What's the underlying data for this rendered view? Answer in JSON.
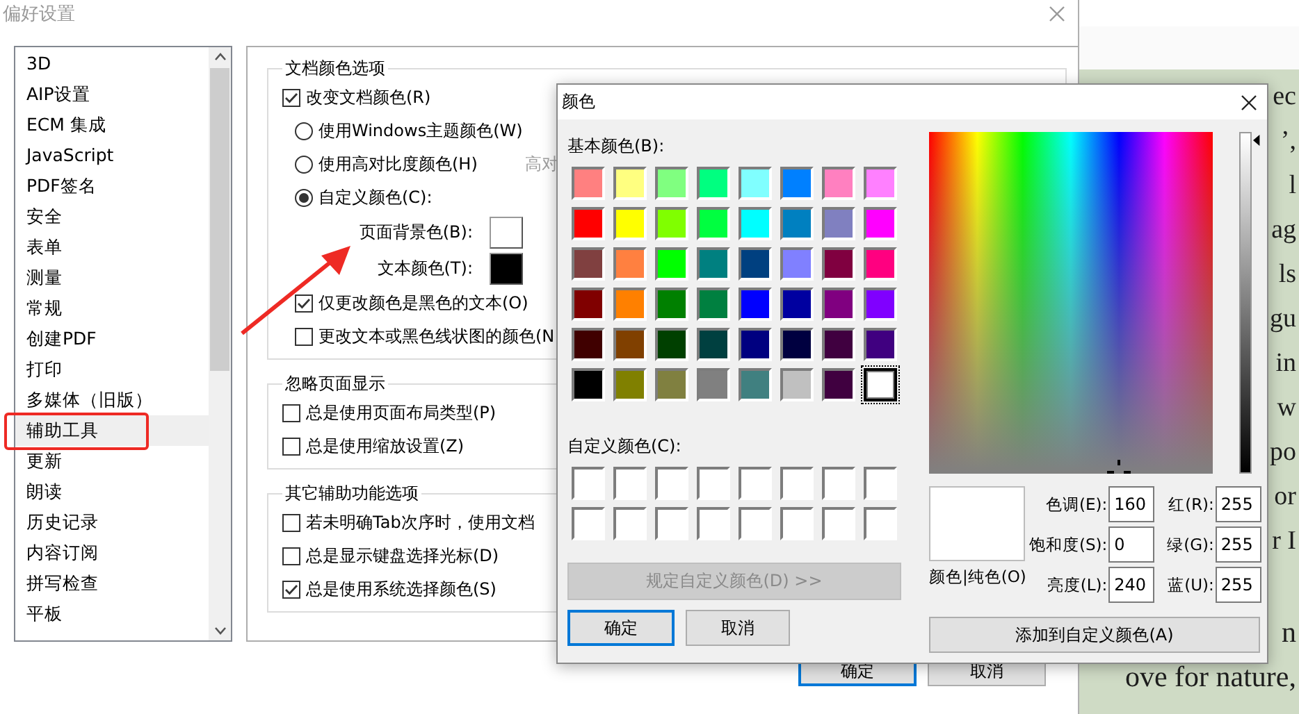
{
  "preferences": {
    "title": "偏好设置",
    "categories": [
      {
        "label": "3D",
        "selected": false
      },
      {
        "label": "AIP设置",
        "selected": false
      },
      {
        "label": "ECM 集成",
        "selected": false
      },
      {
        "label": "JavaScript",
        "selected": false
      },
      {
        "label": "PDF签名",
        "selected": false
      },
      {
        "label": "安全",
        "selected": false
      },
      {
        "label": "表单",
        "selected": false
      },
      {
        "label": "测量",
        "selected": false
      },
      {
        "label": "常规",
        "selected": false
      },
      {
        "label": "创建PDF",
        "selected": false
      },
      {
        "label": "打印",
        "selected": false
      },
      {
        "label": "多媒体（旧版）",
        "selected": false
      },
      {
        "label": "辅助工具",
        "selected": true
      },
      {
        "label": "更新",
        "selected": false
      },
      {
        "label": "朗读",
        "selected": false
      },
      {
        "label": "历史记录",
        "selected": false
      },
      {
        "label": "内容订阅",
        "selected": false
      },
      {
        "label": "拼写检查",
        "selected": false
      },
      {
        "label": "平板",
        "selected": false
      }
    ],
    "groups": [
      {
        "title": "文档颜色选项",
        "items": [
          {
            "kind": "checkbox",
            "label": "改变文档颜色(R)",
            "checked": true,
            "children": [
              {
                "kind": "radio",
                "label": "使用Windows主题颜色(W)",
                "selected": false
              },
              {
                "kind": "radio",
                "label": "使用高对比度颜色(H)",
                "selected": false,
                "aside": "高对"
              },
              {
                "kind": "radio",
                "label": "自定义颜色(C):",
                "selected": true,
                "children": [
                  {
                    "kind": "color",
                    "label": "页面背景色(B):",
                    "color": "#ffffff"
                  },
                  {
                    "kind": "color",
                    "label": "文本颜色(T):",
                    "color": "#000000"
                  }
                ]
              },
              {
                "kind": "checkbox",
                "label": "仅更改颜色是黑色的文本(O)",
                "checked": true
              },
              {
                "kind": "checkbox",
                "label": "更改文本或黑色线状图的颜色(N",
                "checked": false
              }
            ]
          }
        ]
      },
      {
        "title": "忽略页面显示",
        "items": [
          {
            "kind": "checkbox",
            "label": "总是使用页面布局类型(P)",
            "checked": false
          },
          {
            "kind": "checkbox",
            "label": "总是使用缩放设置(Z)",
            "checked": false
          }
        ]
      },
      {
        "title": "其它辅助功能选项",
        "items": [
          {
            "kind": "checkbox",
            "label": "若未明确Tab次序时，使用文档",
            "checked": false
          },
          {
            "kind": "checkbox",
            "label": "总是显示键盘选择光标(D)",
            "checked": false
          },
          {
            "kind": "checkbox",
            "label": "总是使用系统选择颜色(S)",
            "checked": true
          }
        ]
      }
    ],
    "buttons": [
      {
        "label": "确定",
        "default": true
      },
      {
        "label": "取消",
        "default": false
      }
    ]
  },
  "color_dialog": {
    "title": "颜色",
    "basic_label": "基本颜色(B):",
    "basic_colors": [
      {
        "color": "#ff8080",
        "selected": false
      },
      {
        "color": "#ffff80",
        "selected": false
      },
      {
        "color": "#80ff80",
        "selected": false
      },
      {
        "color": "#00ff80",
        "selected": false
      },
      {
        "color": "#80ffff",
        "selected": false
      },
      {
        "color": "#0080ff",
        "selected": false
      },
      {
        "color": "#ff80c0",
        "selected": false
      },
      {
        "color": "#ff80ff",
        "selected": false
      },
      {
        "color": "#ff0000",
        "selected": false
      },
      {
        "color": "#ffff00",
        "selected": false
      },
      {
        "color": "#80ff00",
        "selected": false
      },
      {
        "color": "#00ff40",
        "selected": false
      },
      {
        "color": "#00ffff",
        "selected": false
      },
      {
        "color": "#0080c0",
        "selected": false
      },
      {
        "color": "#8080c0",
        "selected": false
      },
      {
        "color": "#ff00ff",
        "selected": false
      },
      {
        "color": "#804040",
        "selected": false
      },
      {
        "color": "#ff8040",
        "selected": false
      },
      {
        "color": "#00ff00",
        "selected": false
      },
      {
        "color": "#008080",
        "selected": false
      },
      {
        "color": "#004080",
        "selected": false
      },
      {
        "color": "#8080ff",
        "selected": false
      },
      {
        "color": "#800040",
        "selected": false
      },
      {
        "color": "#ff0080",
        "selected": false
      },
      {
        "color": "#800000",
        "selected": false
      },
      {
        "color": "#ff8000",
        "selected": false
      },
      {
        "color": "#008000",
        "selected": false
      },
      {
        "color": "#008040",
        "selected": false
      },
      {
        "color": "#0000ff",
        "selected": false
      },
      {
        "color": "#0000a0",
        "selected": false
      },
      {
        "color": "#800080",
        "selected": false
      },
      {
        "color": "#8000ff",
        "selected": false
      },
      {
        "color": "#400000",
        "selected": false
      },
      {
        "color": "#804000",
        "selected": false
      },
      {
        "color": "#004000",
        "selected": false
      },
      {
        "color": "#004040",
        "selected": false
      },
      {
        "color": "#000080",
        "selected": false
      },
      {
        "color": "#000040",
        "selected": false
      },
      {
        "color": "#400040",
        "selected": false
      },
      {
        "color": "#400080",
        "selected": false
      },
      {
        "color": "#000000",
        "selected": false
      },
      {
        "color": "#808000",
        "selected": false
      },
      {
        "color": "#808040",
        "selected": false
      },
      {
        "color": "#808080",
        "selected": false
      },
      {
        "color": "#408080",
        "selected": false
      },
      {
        "color": "#c0c0c0",
        "selected": false
      },
      {
        "color": "#400040",
        "selected": false
      },
      {
        "color": "#ffffff",
        "selected": true
      }
    ],
    "custom_label": "自定义颜色(C):",
    "custom_colors": [
      {
        "color": "#ffffff"
      },
      {
        "color": "#ffffff"
      },
      {
        "color": "#ffffff"
      },
      {
        "color": "#ffffff"
      },
      {
        "color": "#ffffff"
      },
      {
        "color": "#ffffff"
      },
      {
        "color": "#ffffff"
      },
      {
        "color": "#ffffff"
      },
      {
        "color": "#ffffff"
      },
      {
        "color": "#ffffff"
      },
      {
        "color": "#ffffff"
      },
      {
        "color": "#ffffff"
      },
      {
        "color": "#ffffff"
      },
      {
        "color": "#ffffff"
      },
      {
        "color": "#ffffff"
      },
      {
        "color": "#ffffff"
      }
    ],
    "define_button": {
      "label": "规定自定义颜色(D) >>",
      "disabled": true
    },
    "buttons": [
      {
        "label": "确定",
        "default": true
      },
      {
        "label": "取消",
        "default": false
      }
    ],
    "preview_label": "颜色|纯色(O)",
    "hsl_fields": [
      {
        "label": "色调(E):",
        "value": "160"
      },
      {
        "label": "饱和度(S):",
        "value": "0"
      },
      {
        "label": "亮度(L):",
        "value": "240"
      }
    ],
    "rgb_fields": [
      {
        "label": "红(R):",
        "value": "255"
      },
      {
        "label": "绿(G):",
        "value": "255"
      },
      {
        "label": "蓝(U):",
        "value": "255"
      }
    ],
    "add_button": "添加到自定义颜色(A)"
  },
  "document": {
    "edge_lines": [
      "ec",
      "’,",
      "l",
      "ag",
      "ls",
      "gu",
      "in",
      "w",
      "po",
      "or",
      "r I"
    ],
    "bottom_lines": [
      "n",
      "ove for nature,"
    ]
  }
}
